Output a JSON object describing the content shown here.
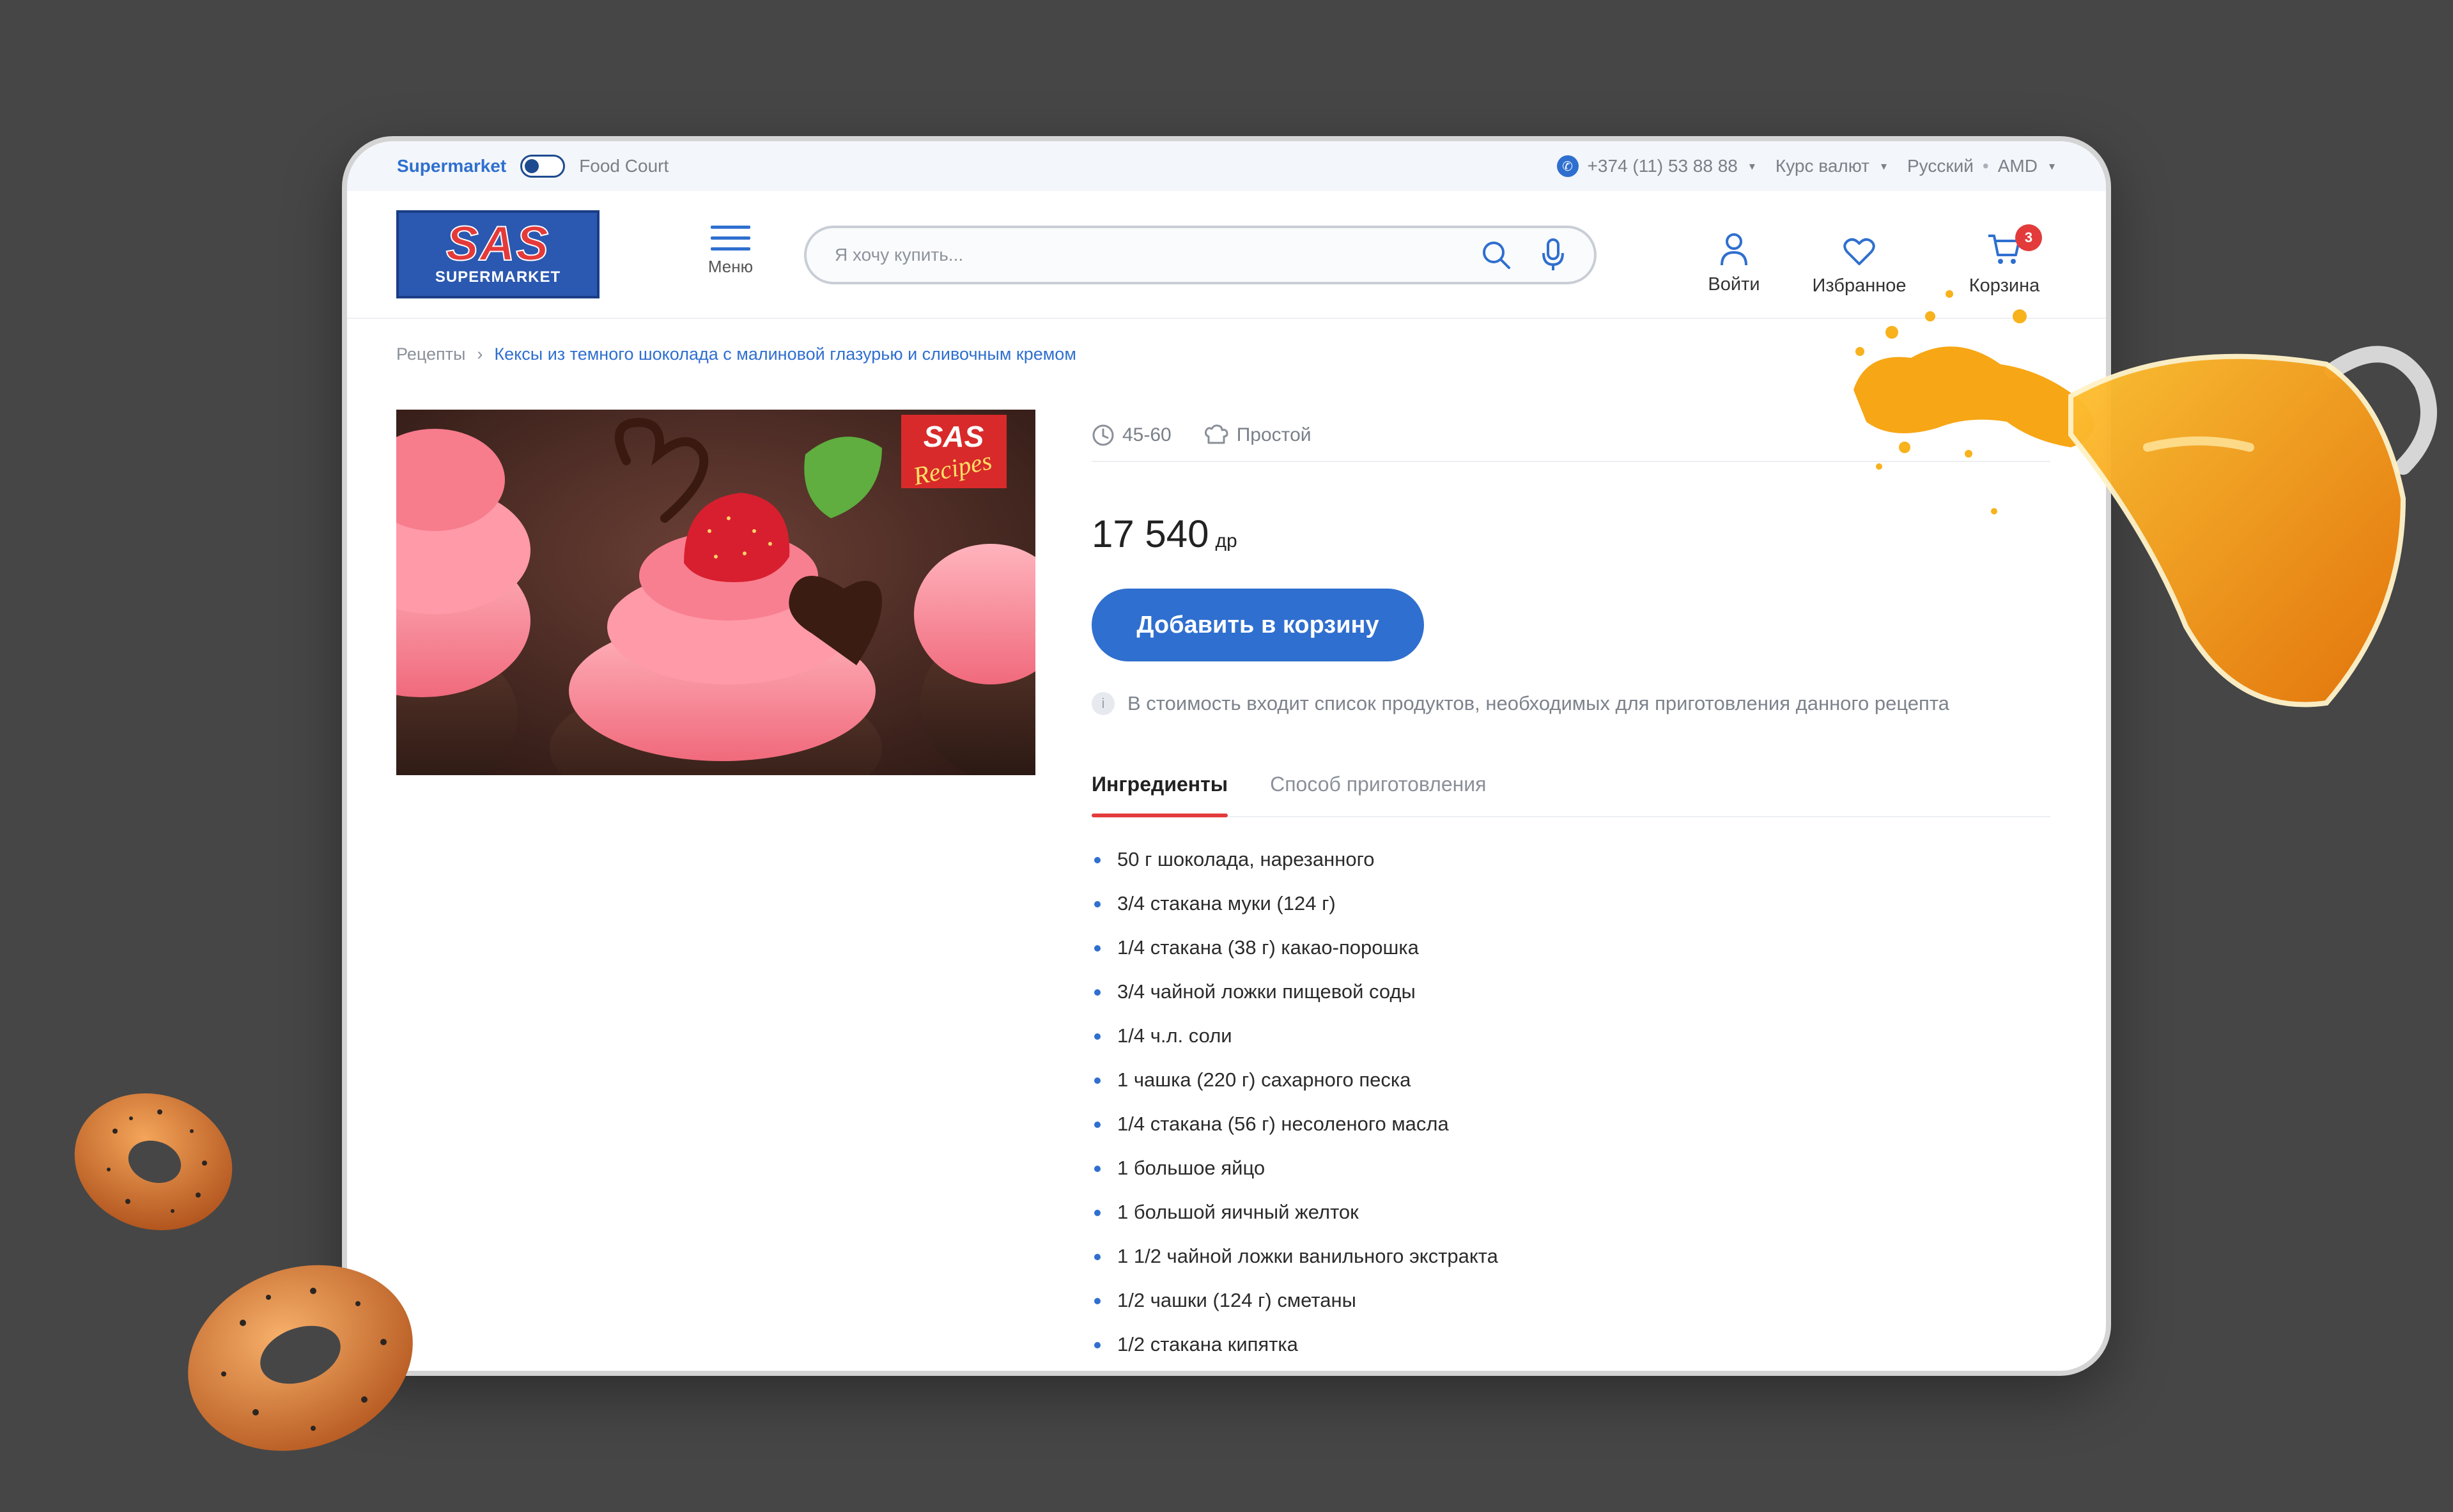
{
  "topbar": {
    "supermarket_label": "Supermarket",
    "foodcourt_label": "Food Court",
    "phone": "+374 (11) 53 88 88",
    "currency_rate": "Курс валют",
    "language": "Русский",
    "currency": "AMD",
    "separator": "•"
  },
  "header": {
    "logo_main": "SAS",
    "logo_sub": "SUPERMARKET",
    "menu_label": "Меню",
    "search_placeholder": "Я хочу купить...",
    "login_label": "Войти",
    "favorites_label": "Избранное",
    "cart_label": "Корзина",
    "cart_count": "3"
  },
  "breadcrumb": {
    "root": "Рецепты",
    "separator": "›",
    "current": "Кексы из темного шоколада с малиновой глазурью и сливочным кремом"
  },
  "recipe": {
    "photo_badge_line1": "SAS",
    "photo_badge_line2": "Recipes",
    "time": "45-60",
    "difficulty": "Простой",
    "price": "17 540",
    "price_currency": "др",
    "add_to_cart": "Добавить  в корзину",
    "note": "В стоимость входит список продуктов, необходимых для приготовления данного рецепта",
    "tabs": [
      "Ингредиенты",
      "Способ приготовления"
    ],
    "ingredients": [
      "50 г шоколада, нарезанного",
      "3/4 стакана муки (124 г)",
      "1/4 стакана (38 г) какао-порошка",
      "3/4 чайной ложки пищевой соды",
      "1/4 ч.л. соли",
      "1 чашка (220 г) сахарного песка",
      "1/4 стакана (56 г) несоленого масла",
      "1 большое яйцо",
      "1 большой яичный желток",
      "1 1/2 чайной ложки ванильного экстракта",
      "1/2 чашки (124 г) сметаны",
      "1/2 стакана кипятка"
    ]
  },
  "colors": {
    "background": "#464646",
    "accent_blue": "#2f6fcf",
    "accent_red": "#e33b3b",
    "juice_orange": "#f39a12"
  }
}
